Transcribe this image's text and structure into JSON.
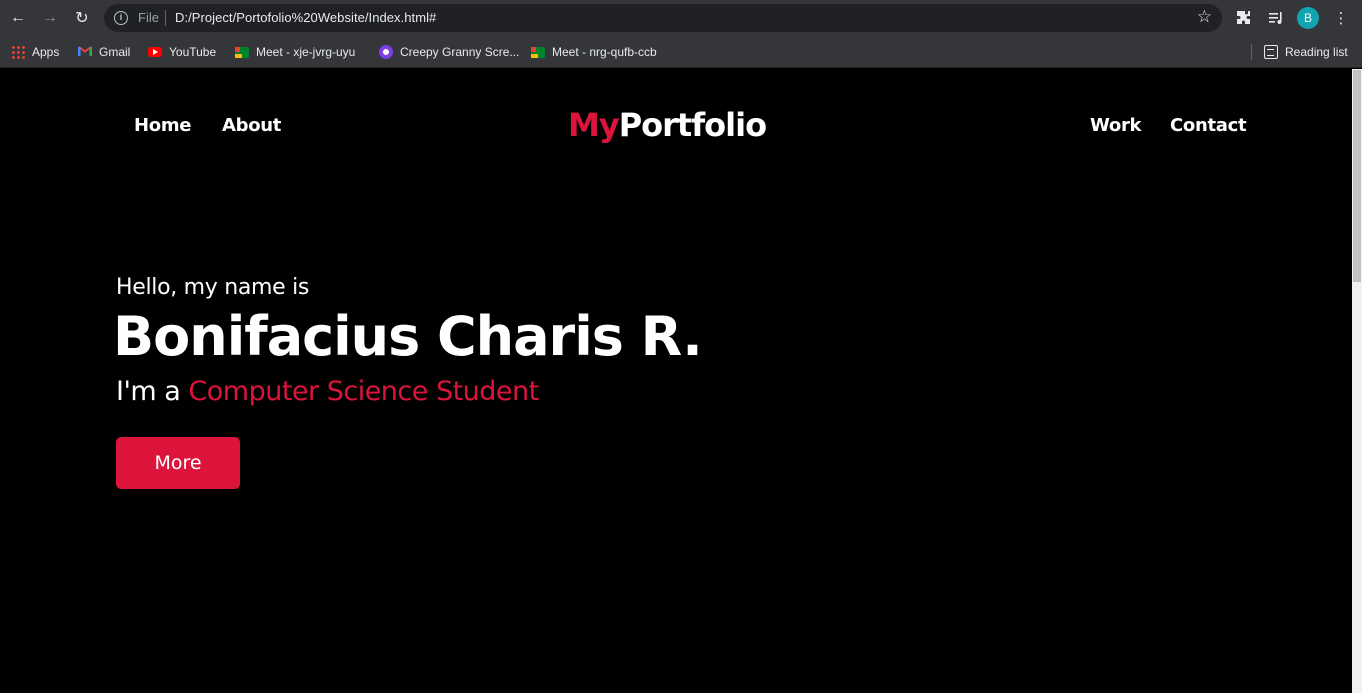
{
  "browser": {
    "omnibox": {
      "scheme_label": "File",
      "url": "D:/Project/Portofolio%20Website/Index.html#"
    },
    "profile_initial": "B",
    "bookmarks": [
      {
        "label": "Apps",
        "icon": "apps-grid-icon"
      },
      {
        "label": "Gmail",
        "icon": "gmail-icon"
      },
      {
        "label": "YouTube",
        "icon": "youtube-icon"
      },
      {
        "label": "Meet - xje-jvrg-uyu",
        "icon": "google-meet-icon"
      },
      {
        "label": "Creepy Granny Scre...",
        "icon": "twitch-icon"
      },
      {
        "label": "Meet - nrg-qufb-ccb",
        "icon": "google-meet-icon"
      }
    ],
    "reading_list": "Reading list"
  },
  "site": {
    "nav_left": [
      "Home",
      "About"
    ],
    "nav_right": [
      "Work",
      "Contact"
    ],
    "logo": {
      "part1": "My",
      "part2": "Portfolio"
    },
    "hero": {
      "greeting": "Hello, my name is",
      "name": "Bonifacius Charis R.",
      "role_prefix": "I'm a ",
      "role": "Computer Science Student",
      "button": "More"
    },
    "colors": {
      "accent": "#dc143c",
      "background": "#000000",
      "text": "#ffffff"
    }
  }
}
